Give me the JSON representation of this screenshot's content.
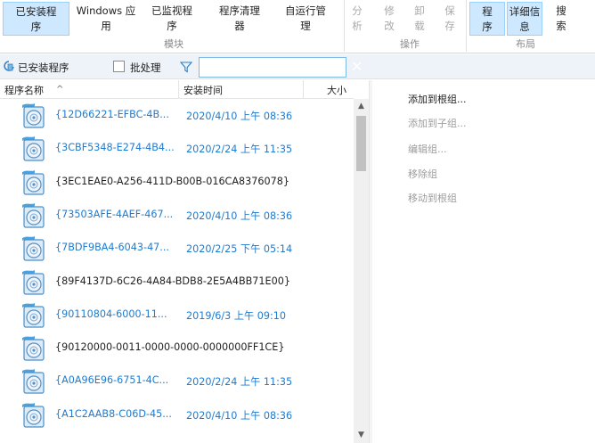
{
  "ribbon": {
    "buttons": [
      {
        "label": "已安装程序",
        "line1": "已安装程",
        "line2": "序"
      },
      {
        "label": "Windows 应用",
        "line1": "Windows 应",
        "line2": "用"
      },
      {
        "label": "已监视程序",
        "line1": "已监视程",
        "line2": "序"
      },
      {
        "label": "程序清理器",
        "line1": "程序清理",
        "line2": "器"
      },
      {
        "label": "自运行管理",
        "line1": "自运行管",
        "line2": "理"
      },
      {
        "label": "分析",
        "line1": "分",
        "line2": "析"
      },
      {
        "label": "修改",
        "line1": "修",
        "line2": "改"
      },
      {
        "label": "卸载",
        "line1": "卸",
        "line2": "载"
      },
      {
        "label": "保存",
        "line1": "保",
        "line2": "存"
      },
      {
        "label": "程序",
        "line1": "程",
        "line2": "序"
      },
      {
        "label": "详细信息",
        "line1": "详细信",
        "line2": "息"
      },
      {
        "label": "搜索",
        "line1": "搜",
        "line2": "索"
      }
    ],
    "groups": {
      "modules": "模块",
      "actions": "操作",
      "layout": "布局"
    }
  },
  "filterbar": {
    "installed_label": "已安装程序",
    "batch_label": "批处理",
    "batch_checked": false,
    "search_value": "",
    "search_placeholder": "",
    "clear_glyph": "✕"
  },
  "list": {
    "headers": {
      "name": "程序名称",
      "sort_glyph": "^",
      "date": "安装时间",
      "size": "大小"
    },
    "rows": [
      {
        "name": "{12D66221-EFBC-4B...",
        "date": "2020/4/10 上午 08:36",
        "linked": true
      },
      {
        "name": "{3CBF5348-E274-4B4...",
        "date": "2020/2/24 上午 11:35",
        "linked": true
      },
      {
        "name": "{3EC1EAE0-A256-411D-B00B-016CA8376078}",
        "date": "",
        "linked": false
      },
      {
        "name": "{73503AFE-4AEF-467...",
        "date": "2020/4/10 上午 08:36",
        "linked": true
      },
      {
        "name": "{7BDF9BA4-6043-47...",
        "date": "2020/2/25 下午 05:14",
        "linked": true
      },
      {
        "name": "{89F4137D-6C26-4A84-BDB8-2E5A4BB71E00}",
        "date": "",
        "linked": false
      },
      {
        "name": "{90110804-6000-11...",
        "date": "2019/6/3 上午 09:10",
        "linked": true
      },
      {
        "name": "{90120000-0011-0000-0000-0000000FF1CE}",
        "date": "",
        "linked": false
      },
      {
        "name": "{A0A96E96-6751-4C...",
        "date": "2020/2/24 上午 11:35",
        "linked": true
      },
      {
        "name": "{A1C2AAB8-C06D-45...",
        "date": "2020/4/10 上午 08:36",
        "linked": true
      }
    ]
  },
  "scrollbar": {
    "up_glyph": "▲",
    "down_glyph": "▼",
    "position_fraction": 0.0
  },
  "groups_pane": {
    "items": [
      {
        "label": "添加到根组...",
        "enabled": true
      },
      {
        "label": "添加到子组...",
        "enabled": false
      },
      {
        "label": "编辑组...",
        "enabled": false
      },
      {
        "label": "移除组",
        "enabled": false
      },
      {
        "label": "移动到根组",
        "enabled": false
      }
    ]
  },
  "colors": {
    "accent_blue": "#1f7bd1",
    "active_tab_bg": "#cde8ff",
    "active_tab_border": "#99d1ff",
    "filterbar_bg": "#eef3f9",
    "disabled_text": "#9d9d9d"
  },
  "icons": {
    "installed": "installed-programs-icon",
    "filter": "filter-funnel-icon",
    "clear": "clear-search-icon",
    "program": "program-installer-disc-icon"
  }
}
